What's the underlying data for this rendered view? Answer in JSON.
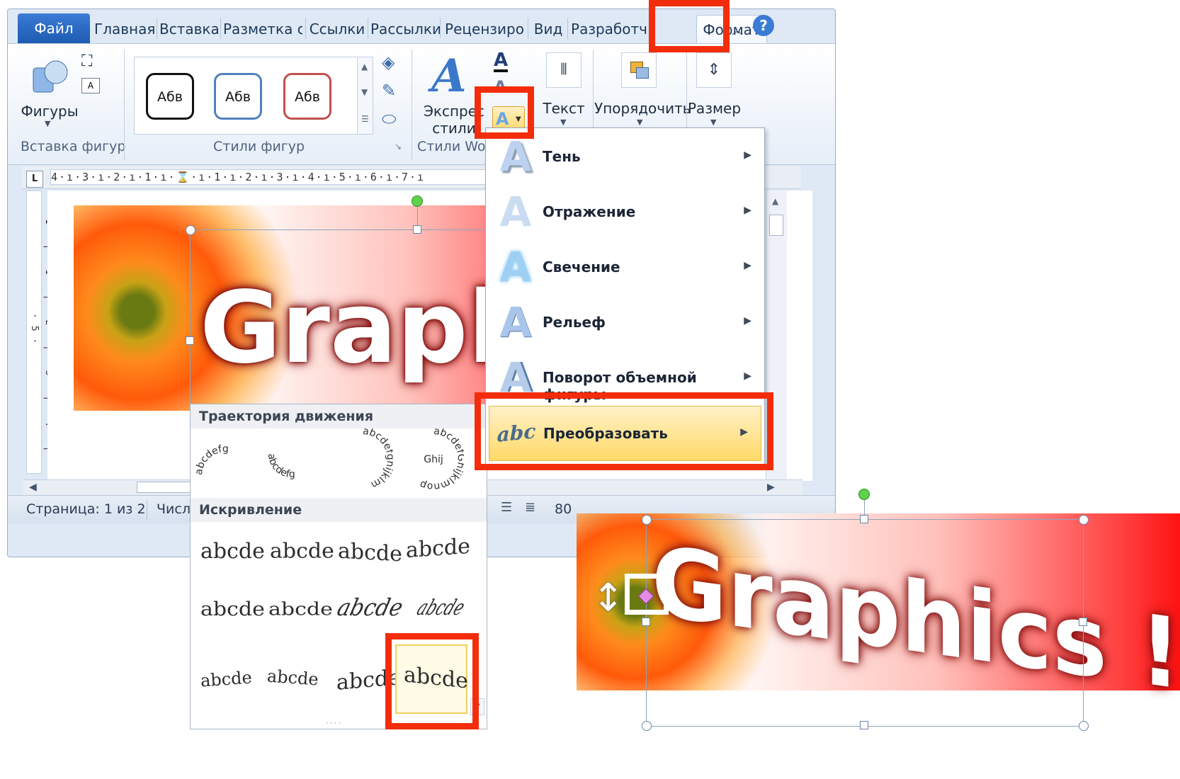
{
  "tabs": [
    {
      "label": "Файл"
    },
    {
      "label": "Главная"
    },
    {
      "label": "Вставка"
    },
    {
      "label": "Разметка ст"
    },
    {
      "label": "Ссылки"
    },
    {
      "label": "Рассылки"
    },
    {
      "label": "Рецензиро"
    },
    {
      "label": "Вид"
    },
    {
      "label": "Разработч"
    },
    {
      "label": "Формат"
    }
  ],
  "ribbon": {
    "shapes_label": "Фигуры",
    "group_insert_shapes": "Вставка фигур",
    "style_samples": [
      "Абв",
      "Абв",
      "Абв"
    ],
    "group_shape_styles": "Стили фигур",
    "express_label_1": "Экспрес",
    "express_label_2": "стили",
    "group_wordart_styles": "Стили Wo",
    "text_label": "Текст",
    "arrange_label": "Упорядочить",
    "size_label": "Размер"
  },
  "ruler": {
    "corner": "L",
    "scale": "4·ı·3·ı·2·ı·1·ı·⌛·ı·1·ı·2·ı·3·ı·4·ı·5·ı·6·ı·7·ı",
    "vertical": "·1·|·1·|·2·|·3·|·4·|·5·"
  },
  "document": {
    "wordart": "Graphi"
  },
  "status": {
    "page": "Страница: 1 из 2",
    "words": "Числ",
    "zoom": "80"
  },
  "effects_menu": {
    "items": [
      {
        "label": "Тень",
        "icon": "text-shadow-icon"
      },
      {
        "label": "Отражение",
        "icon": "text-reflection-icon"
      },
      {
        "label": "Свечение",
        "icon": "text-glow-icon"
      },
      {
        "label": "Рельеф",
        "icon": "text-bevel-icon"
      },
      {
        "label": "Поворот объемной фигуры",
        "icon": "text-3d-rotation-icon"
      },
      {
        "label": "Преобразовать",
        "icon": "text-transform-icon"
      }
    ]
  },
  "transform_panel": {
    "section_path": "Траектория движения",
    "section_warp": "Искривление",
    "path_samples": [
      "abcdefg",
      "abcdefg",
      "abcdefghijklm",
      "abcdefGhijklmnop"
    ],
    "path_extra": "Ghij",
    "warp_samples": [
      "abcde",
      "abcde",
      "abcde",
      "abcde",
      "abcde",
      "abcde",
      "abcde",
      "abcde",
      "abcde",
      "abcde",
      "abcde",
      "abcde"
    ]
  },
  "result": {
    "wordart": "Graphics !"
  },
  "colors": {
    "highlight": "#f32d0c",
    "ribbon_blue": "#1f5bb2",
    "menu_hover": "#ffd968"
  }
}
